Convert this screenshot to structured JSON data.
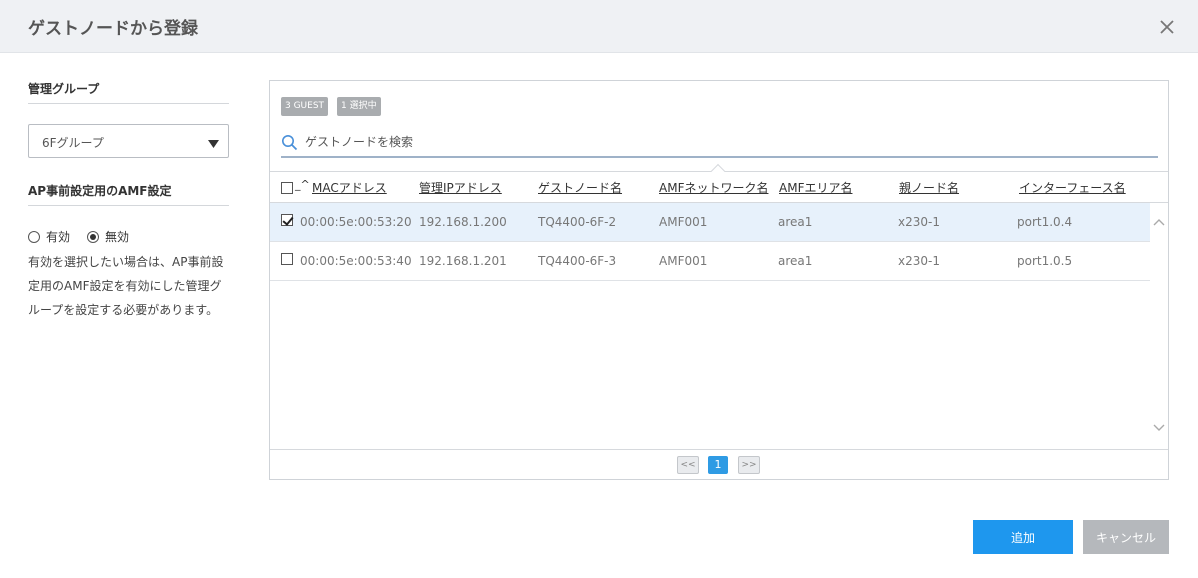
{
  "dialog": {
    "title": "ゲストノードから登録"
  },
  "left": {
    "group_label": "管理グループ",
    "group_select_value": "6Fグループ",
    "amf_label": "AP事前設定用のAMF設定",
    "radio_enable": "有効",
    "radio_disable": "無効",
    "radio_selected": "無効",
    "note": "有効を選択したい場合は、AP事前設定用のAMF設定を有効にした管理グループを設定する必要があります。"
  },
  "panel": {
    "badge_guest": "3 GUEST",
    "badge_selected": "1 選択中",
    "search_placeholder": "ゲストノードを検索",
    "header_extra": "_^",
    "columns": [
      "MACアドレス",
      "管理IPアドレス",
      "ゲストノード名",
      "AMFネットワーク名",
      "AMFエリア名",
      "親ノード名",
      "インターフェース名"
    ],
    "rows": [
      {
        "checked": true,
        "mac": "00:00:5e:00:53:20",
        "ip": "192.168.1.200",
        "name": "TQ4400-6F-2",
        "amf_net": "AMF001",
        "area": "area1",
        "parent": "x230-1",
        "iface": "port1.0.4"
      },
      {
        "checked": false,
        "mac": "00:00:5e:00:53:40",
        "ip": "192.168.1.201",
        "name": "TQ4400-6F-3",
        "amf_net": "AMF001",
        "area": "area1",
        "parent": "x230-1",
        "iface": "port1.0.5"
      }
    ],
    "pager": {
      "first": "<<",
      "current": "1",
      "last": ">>"
    }
  },
  "footer": {
    "add": "追加",
    "cancel": "キャンセル"
  },
  "colors": {
    "accent": "#1e97ee",
    "selected_row": "#e7f1fb",
    "header_bg": "#eff1f4",
    "badge": "#a9acaf",
    "cancel": "#b5b8bc",
    "page_current": "#2f9be4"
  }
}
